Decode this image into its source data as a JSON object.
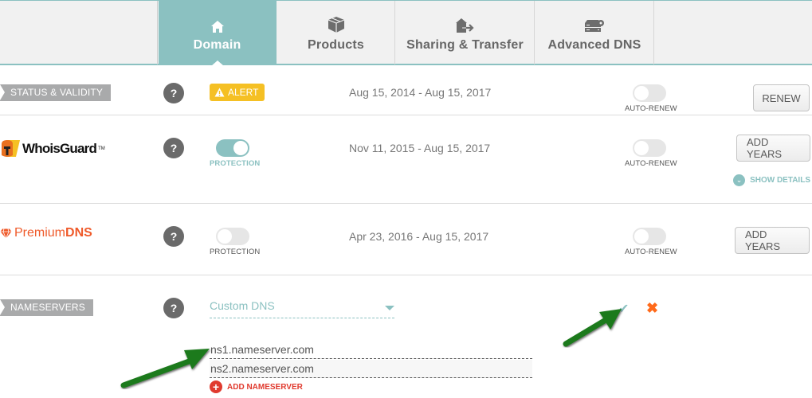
{
  "tabs": [
    {
      "label": "Domain",
      "icon": "home-icon",
      "active": true
    },
    {
      "label": "Products",
      "icon": "box-icon",
      "active": false
    },
    {
      "label": "Sharing & Transfer",
      "icon": "house-arrow-icon",
      "active": false
    },
    {
      "label": "Advanced DNS",
      "icon": "server-gear-icon",
      "active": false
    }
  ],
  "status": {
    "section_label": "STATUS & VALIDITY",
    "help": "?",
    "alert_label": "ALERT",
    "date_range": "Aug 15, 2014 - Aug 15, 2017",
    "auto_renew_label": "AUTO-RENEW",
    "auto_renew_on": false,
    "button_label": "RENEW"
  },
  "whoisguard": {
    "logo_text": "WhoisGuard",
    "logo_tm": "TM",
    "help": "?",
    "protection_label": "PROTECTION",
    "protection_on": true,
    "date_range": "Nov 11, 2015 - Aug 15, 2017",
    "auto_renew_label": "AUTO-RENEW",
    "auto_renew_on": false,
    "button_label": "ADD YEARS",
    "show_details_label": "SHOW DETAILS"
  },
  "premiumdns": {
    "logo_text_light": "Premium",
    "logo_text_bold": "DNS",
    "help": "?",
    "protection_label": "PROTECTION",
    "protection_on": false,
    "date_range": "Apr 23, 2016 - Aug 15, 2017",
    "auto_renew_label": "AUTO-RENEW",
    "auto_renew_on": false,
    "button_label": "ADD YEARS"
  },
  "nameservers": {
    "section_label": "NAMESERVERS",
    "help": "?",
    "selected_option": "Custom DNS",
    "entries": [
      "ns1.nameserver.com",
      "ns2.nameserver.com"
    ],
    "add_label": "ADD NAMESERVER",
    "confirm_icon": "check-icon",
    "cancel_icon": "close-icon"
  },
  "colors": {
    "accent": "#8bc1c1",
    "alert": "#f5c024",
    "premium": "#ef5a2a",
    "danger": "#e03a2e",
    "annotation_arrow": "#1f7a1f"
  }
}
